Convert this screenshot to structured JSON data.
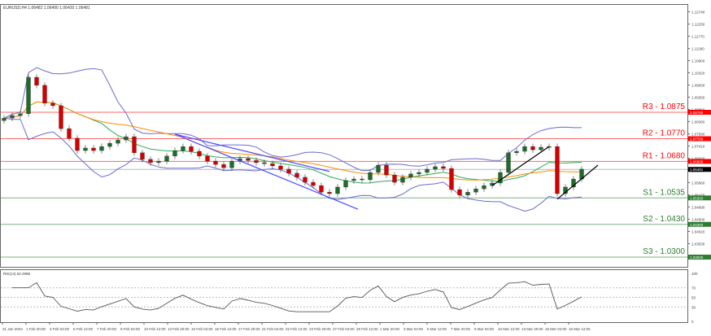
{
  "header": {
    "symbol_line": "EURUSD,H4  1.06482 1.06490 1.06420 1.06481"
  },
  "chart_data": {
    "type": "candlestick",
    "symbol": "EURUSD",
    "timeframe": "H4",
    "price_axis": {
      "ylim": [
        1.0292,
        1.129
      ],
      "ticks": [
        "1.12740",
        "1.12250",
        "1.11770",
        "1.11280",
        "1.10800",
        "1.10320",
        "1.09830",
        "1.09350",
        "1.08860",
        "1.08380",
        "1.07890",
        "1.07410",
        "1.06920",
        "1.06440",
        "1.05960",
        "1.05470",
        "1.04990",
        "1.04500",
        "1.04020",
        "1.03530",
        "1.03050"
      ],
      "tick_values": [
        1.1274,
        1.1225,
        1.1177,
        1.1128,
        1.108,
        1.1032,
        1.0983,
        1.0935,
        1.0886,
        1.0838,
        1.0789,
        1.0741,
        1.0692,
        1.0644,
        1.0596,
        1.0547,
        1.0499,
        1.045,
        1.0402,
        1.0353,
        1.0305
      ]
    },
    "time_labels": [
      "31 Jan 2023",
      "1 Feb 20:00",
      "3 Feb 04:00",
      "6 Feb 12:00",
      "7 Feb 20:00",
      "9 Feb 04:00",
      "10 Feb 12:00",
      "13 Feb 20:00",
      "15 Feb 04:00",
      "16 Feb 12:00",
      "17 Feb 20:00",
      "21 Feb 04:00",
      "22 Feb 12:00",
      "23 Feb 20:00",
      "27 Feb 04:00",
      "28 Feb 12:00",
      "1 Mar 20:00",
      "3 Mar 04:00",
      "6 Mar 12:00",
      "7 Mar 20:00",
      "9 Mar 04:00",
      "10 Mar 12:00",
      "13 Mar 20:00",
      "15 Mar 04:00",
      "16 Mar 12:00"
    ],
    "closes": [
      1.0852,
      1.0862,
      1.0869,
      1.1014,
      1.0982,
      1.0911,
      1.0901,
      1.081,
      1.0772,
      1.0723,
      1.0733,
      1.0723,
      1.0739,
      1.0752,
      1.0765,
      1.0778,
      1.0714,
      1.0688,
      1.0675,
      1.0681,
      1.0701,
      1.0723,
      1.0739,
      1.072,
      1.0701,
      1.0681,
      1.0668,
      1.0655,
      1.0681,
      1.0691,
      1.0684,
      1.0675,
      1.0671,
      1.0662,
      1.0649,
      1.0633,
      1.0617,
      1.0597,
      1.0584,
      1.0558,
      1.0552,
      1.0578,
      1.0604,
      1.061,
      1.0607,
      1.0636,
      1.0665,
      1.0626,
      1.0597,
      1.0617,
      1.063,
      1.0636,
      1.0649,
      1.0659,
      1.0652,
      1.0568,
      1.0546,
      1.0558,
      1.0571,
      1.0584,
      1.0594,
      1.0636,
      1.0714,
      1.072,
      1.0739,
      1.0726,
      1.0736,
      1.0739,
      1.0552,
      1.0578,
      1.061,
      1.0649
    ],
    "current_price": {
      "value": 1.06481,
      "label": "1.06481"
    },
    "levels": [
      {
        "name": "R3 - 1.0875",
        "value": 1.0875,
        "label": "1.08750",
        "color": "#ff0000"
      },
      {
        "name": "R2 - 1.0770",
        "value": 1.077,
        "label": "1.07700",
        "color": "#ff0000"
      },
      {
        "name": "R1 - 1.0680",
        "value": 1.068,
        "label": "1.06800",
        "color": "#ff0000"
      },
      {
        "name": "S1 - 1.0535",
        "value": 1.0535,
        "label": "1.05350",
        "color": "#2e7d32"
      },
      {
        "name": "S2 - 1.0430",
        "value": 1.043,
        "label": "1.04300",
        "color": "#2e7d32"
      },
      {
        "name": "S3 - 1.0300",
        "value": 1.03,
        "label": "1.03000",
        "color": "#2e7d32"
      }
    ],
    "trendlines": [
      {
        "color": "#4a4aff",
        "from": [
          21,
          1.0788
        ],
        "to": [
          43.5,
          1.049
        ]
      },
      {
        "color": "#4a4aff",
        "from": [
          21,
          1.0788
        ],
        "to": [
          40,
          1.064
        ]
      },
      {
        "color": "#000000",
        "from": [
          60,
          1.0584
        ],
        "to": [
          67,
          1.0739
        ]
      },
      {
        "color": "#000000",
        "from": [
          68,
          1.053
        ],
        "to": [
          73,
          1.0665
        ]
      }
    ],
    "colors": {
      "bull": "#1e6b2a",
      "bear": "#d40000",
      "ma_fast": "#2eaa55",
      "ma_slow": "#ff8c00",
      "bands": "#6b6bd0",
      "rsi": "#555555"
    },
    "rsi": {
      "label": "RSI(14) 52.2988",
      "ticks": [
        "100",
        "70",
        "50",
        "30",
        "0"
      ],
      "tick_values": [
        100,
        70,
        50,
        30,
        0
      ],
      "ylim": [
        0,
        100
      ]
    }
  }
}
